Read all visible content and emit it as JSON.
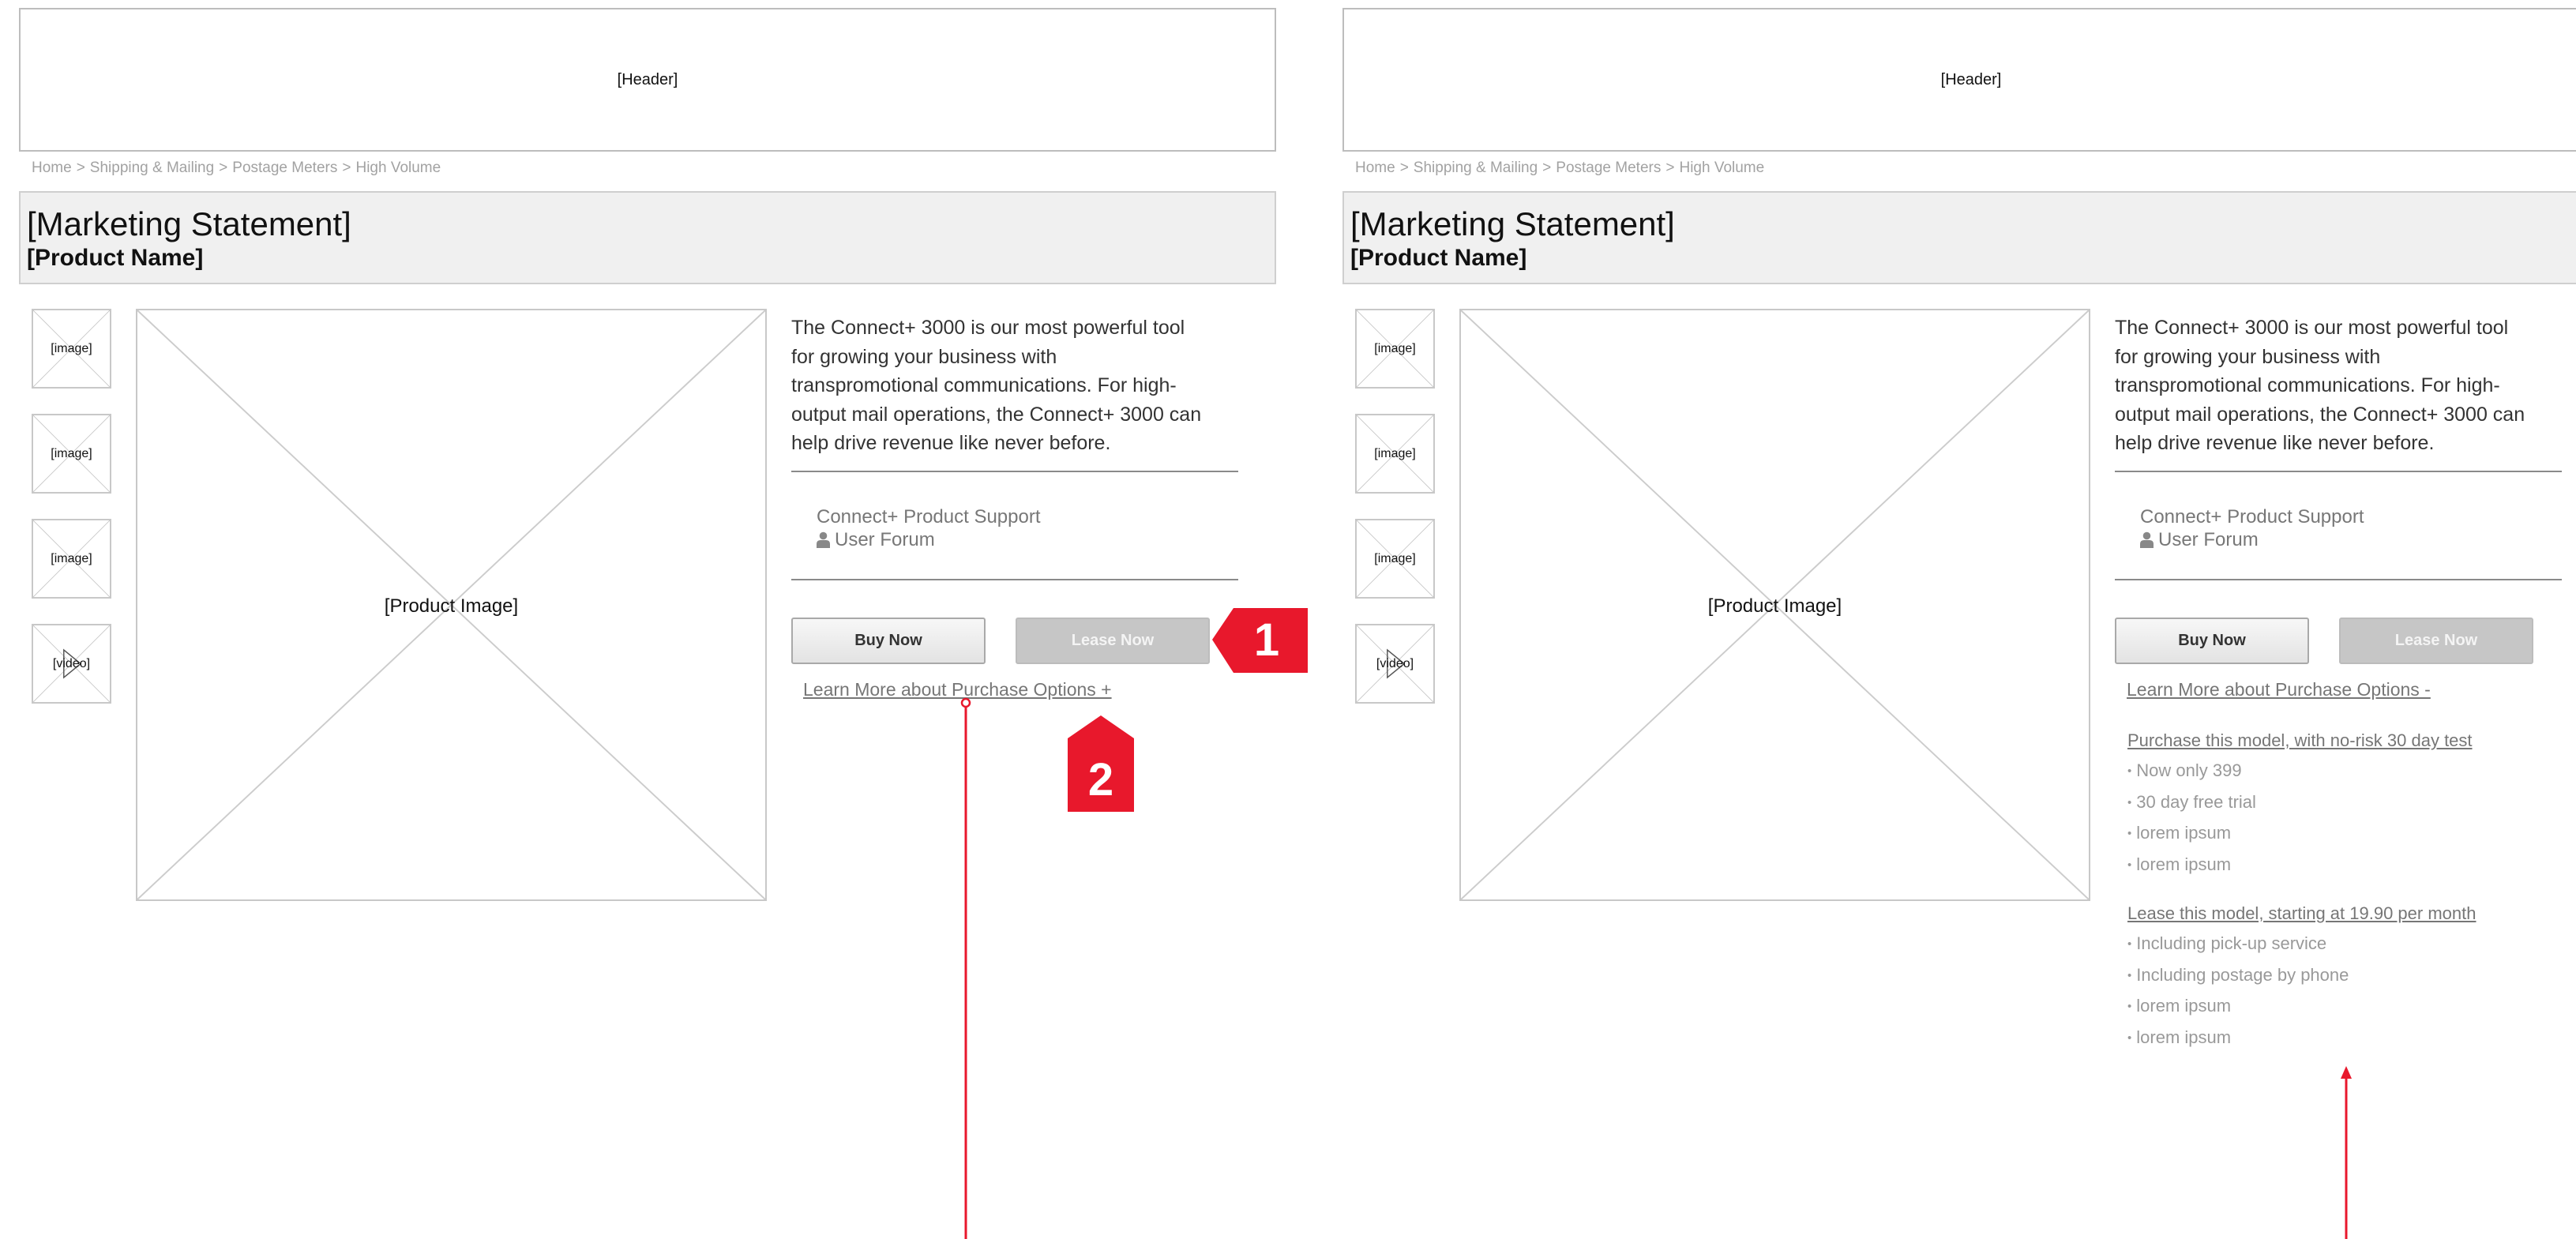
{
  "colors": {
    "annotation_red": "#e8182c",
    "marketing_bg": "#f0f0f0",
    "lease_disabled": "#c6c6c6"
  },
  "left": {
    "header": "[Header]",
    "breadcrumb": [
      "Home",
      "Shipping & Mailing",
      "Postage Meters",
      "High Volume"
    ],
    "breadcrumb_sep": ">",
    "marketing_statement": "[Marketing Statement]",
    "product_name": "[Product Name]",
    "thumbnails": [
      "[image]",
      "[image]",
      "[image]",
      "[video]"
    ],
    "product_image": "[Product Image]",
    "description": "The Connect+ 3000 is our most powerful tool for growing your business with transpromotional communications. For high-output mail operations, the Connect+ 3000 can help drive revenue like never before.",
    "support_link": "Connect+ Product Support",
    "forum_link": "User Forum",
    "user_icon": "user-icon",
    "buy_button": "Buy Now",
    "lease_button": "Lease Now",
    "learn_more": "Learn More about Purchase Options +"
  },
  "right": {
    "header": "[Header]",
    "breadcrumb": [
      "Home",
      "Shipping & Mailing",
      "Postage Meters",
      "High Volume"
    ],
    "breadcrumb_sep": ">",
    "marketing_statement": "[Marketing Statement]",
    "product_name": "[Product Name]",
    "thumbnails": [
      "[image]",
      "[image]",
      "[image]",
      "[video]"
    ],
    "product_image": "[Product Image]",
    "description": "The Connect+ 3000 is our most powerful tool for growing your business with transpromotional communications. For high-output mail operations, the Connect+ 3000 can help drive revenue like never before.",
    "support_link": "Connect+ Product Support",
    "forum_link": "User Forum",
    "user_icon": "user-icon",
    "buy_button": "Buy Now",
    "lease_button": "Lease Now",
    "learn_more": "Learn More about Purchase Options -",
    "purchase_heading": "Purchase this model, with no-risk 30 day test",
    "purchase_items": [
      "Now only 399",
      "30 day free trial",
      "lorem ipsum",
      "lorem ipsum"
    ],
    "lease_heading": "Lease this model, starting at 19.90 per month",
    "lease_items": [
      "Including pick-up service",
      "Including postage by phone",
      "lorem ipsum",
      "lorem ipsum"
    ]
  },
  "annotations": {
    "marker_1": "1",
    "marker_2": "2"
  }
}
